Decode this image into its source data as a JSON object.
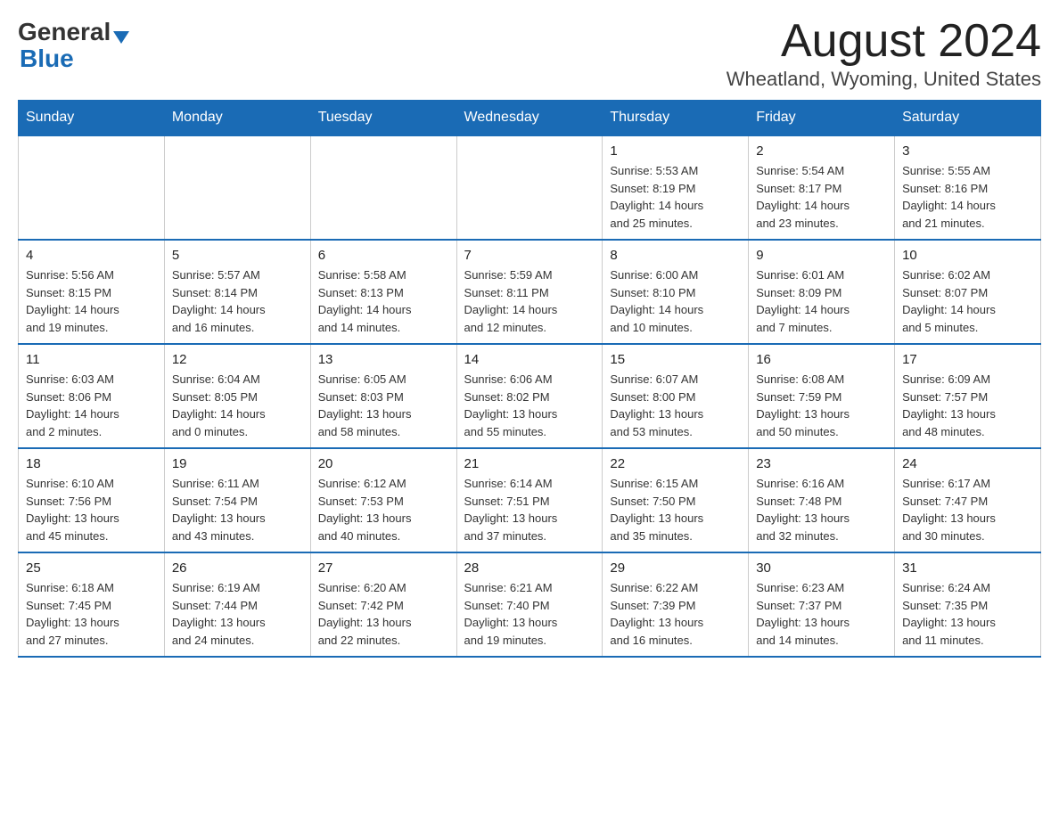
{
  "header": {
    "logo_general": "General",
    "logo_blue": "Blue",
    "month_title": "August 2024",
    "location": "Wheatland, Wyoming, United States"
  },
  "days_of_week": [
    "Sunday",
    "Monday",
    "Tuesday",
    "Wednesday",
    "Thursday",
    "Friday",
    "Saturday"
  ],
  "weeks": [
    [
      {
        "day": "",
        "info": ""
      },
      {
        "day": "",
        "info": ""
      },
      {
        "day": "",
        "info": ""
      },
      {
        "day": "",
        "info": ""
      },
      {
        "day": "1",
        "info": "Sunrise: 5:53 AM\nSunset: 8:19 PM\nDaylight: 14 hours\nand 25 minutes."
      },
      {
        "day": "2",
        "info": "Sunrise: 5:54 AM\nSunset: 8:17 PM\nDaylight: 14 hours\nand 23 minutes."
      },
      {
        "day": "3",
        "info": "Sunrise: 5:55 AM\nSunset: 8:16 PM\nDaylight: 14 hours\nand 21 minutes."
      }
    ],
    [
      {
        "day": "4",
        "info": "Sunrise: 5:56 AM\nSunset: 8:15 PM\nDaylight: 14 hours\nand 19 minutes."
      },
      {
        "day": "5",
        "info": "Sunrise: 5:57 AM\nSunset: 8:14 PM\nDaylight: 14 hours\nand 16 minutes."
      },
      {
        "day": "6",
        "info": "Sunrise: 5:58 AM\nSunset: 8:13 PM\nDaylight: 14 hours\nand 14 minutes."
      },
      {
        "day": "7",
        "info": "Sunrise: 5:59 AM\nSunset: 8:11 PM\nDaylight: 14 hours\nand 12 minutes."
      },
      {
        "day": "8",
        "info": "Sunrise: 6:00 AM\nSunset: 8:10 PM\nDaylight: 14 hours\nand 10 minutes."
      },
      {
        "day": "9",
        "info": "Sunrise: 6:01 AM\nSunset: 8:09 PM\nDaylight: 14 hours\nand 7 minutes."
      },
      {
        "day": "10",
        "info": "Sunrise: 6:02 AM\nSunset: 8:07 PM\nDaylight: 14 hours\nand 5 minutes."
      }
    ],
    [
      {
        "day": "11",
        "info": "Sunrise: 6:03 AM\nSunset: 8:06 PM\nDaylight: 14 hours\nand 2 minutes."
      },
      {
        "day": "12",
        "info": "Sunrise: 6:04 AM\nSunset: 8:05 PM\nDaylight: 14 hours\nand 0 minutes."
      },
      {
        "day": "13",
        "info": "Sunrise: 6:05 AM\nSunset: 8:03 PM\nDaylight: 13 hours\nand 58 minutes."
      },
      {
        "day": "14",
        "info": "Sunrise: 6:06 AM\nSunset: 8:02 PM\nDaylight: 13 hours\nand 55 minutes."
      },
      {
        "day": "15",
        "info": "Sunrise: 6:07 AM\nSunset: 8:00 PM\nDaylight: 13 hours\nand 53 minutes."
      },
      {
        "day": "16",
        "info": "Sunrise: 6:08 AM\nSunset: 7:59 PM\nDaylight: 13 hours\nand 50 minutes."
      },
      {
        "day": "17",
        "info": "Sunrise: 6:09 AM\nSunset: 7:57 PM\nDaylight: 13 hours\nand 48 minutes."
      }
    ],
    [
      {
        "day": "18",
        "info": "Sunrise: 6:10 AM\nSunset: 7:56 PM\nDaylight: 13 hours\nand 45 minutes."
      },
      {
        "day": "19",
        "info": "Sunrise: 6:11 AM\nSunset: 7:54 PM\nDaylight: 13 hours\nand 43 minutes."
      },
      {
        "day": "20",
        "info": "Sunrise: 6:12 AM\nSunset: 7:53 PM\nDaylight: 13 hours\nand 40 minutes."
      },
      {
        "day": "21",
        "info": "Sunrise: 6:14 AM\nSunset: 7:51 PM\nDaylight: 13 hours\nand 37 minutes."
      },
      {
        "day": "22",
        "info": "Sunrise: 6:15 AM\nSunset: 7:50 PM\nDaylight: 13 hours\nand 35 minutes."
      },
      {
        "day": "23",
        "info": "Sunrise: 6:16 AM\nSunset: 7:48 PM\nDaylight: 13 hours\nand 32 minutes."
      },
      {
        "day": "24",
        "info": "Sunrise: 6:17 AM\nSunset: 7:47 PM\nDaylight: 13 hours\nand 30 minutes."
      }
    ],
    [
      {
        "day": "25",
        "info": "Sunrise: 6:18 AM\nSunset: 7:45 PM\nDaylight: 13 hours\nand 27 minutes."
      },
      {
        "day": "26",
        "info": "Sunrise: 6:19 AM\nSunset: 7:44 PM\nDaylight: 13 hours\nand 24 minutes."
      },
      {
        "day": "27",
        "info": "Sunrise: 6:20 AM\nSunset: 7:42 PM\nDaylight: 13 hours\nand 22 minutes."
      },
      {
        "day": "28",
        "info": "Sunrise: 6:21 AM\nSunset: 7:40 PM\nDaylight: 13 hours\nand 19 minutes."
      },
      {
        "day": "29",
        "info": "Sunrise: 6:22 AM\nSunset: 7:39 PM\nDaylight: 13 hours\nand 16 minutes."
      },
      {
        "day": "30",
        "info": "Sunrise: 6:23 AM\nSunset: 7:37 PM\nDaylight: 13 hours\nand 14 minutes."
      },
      {
        "day": "31",
        "info": "Sunrise: 6:24 AM\nSunset: 7:35 PM\nDaylight: 13 hours\nand 11 minutes."
      }
    ]
  ]
}
